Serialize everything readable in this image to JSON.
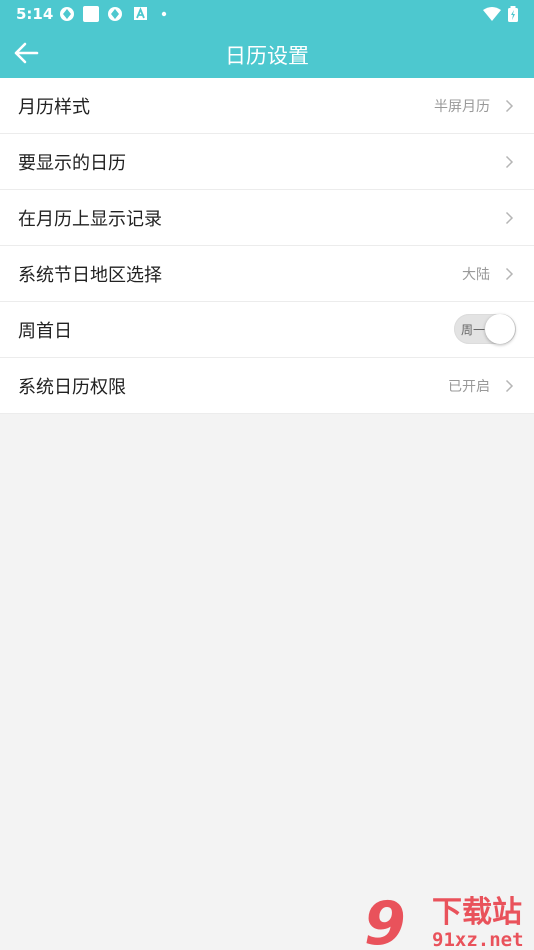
{
  "status_bar": {
    "time": "5:14",
    "left_icons": [
      "aperture-icon",
      "square-icon",
      "aperture-icon",
      "a-box-icon",
      "dot-icon"
    ],
    "right_icons": [
      "wifi-icon",
      "battery-icon"
    ]
  },
  "app_bar": {
    "back_icon": "arrow-left-icon",
    "title": "日历设置"
  },
  "settings": [
    {
      "label": "月历样式",
      "value": "半屏月历"
    },
    {
      "label": "要显示的日历",
      "value": ""
    },
    {
      "label": "在月历上显示记录",
      "value": ""
    },
    {
      "label": "系统节日地区选择",
      "value": "大陆"
    },
    {
      "label": "周首日",
      "toggle_text": "周一"
    },
    {
      "label": "系统日历权限",
      "value": "已开启"
    }
  ],
  "watermark": {
    "logo_mark": "9",
    "title": "下载站",
    "domain": "91xz.net"
  },
  "colors": {
    "accent": "#4dc8cf",
    "background": "#f3f3f3",
    "row_bg": "#ffffff",
    "label_text": "#222222",
    "value_text": "#999999",
    "watermark_red": "#e8404a"
  }
}
